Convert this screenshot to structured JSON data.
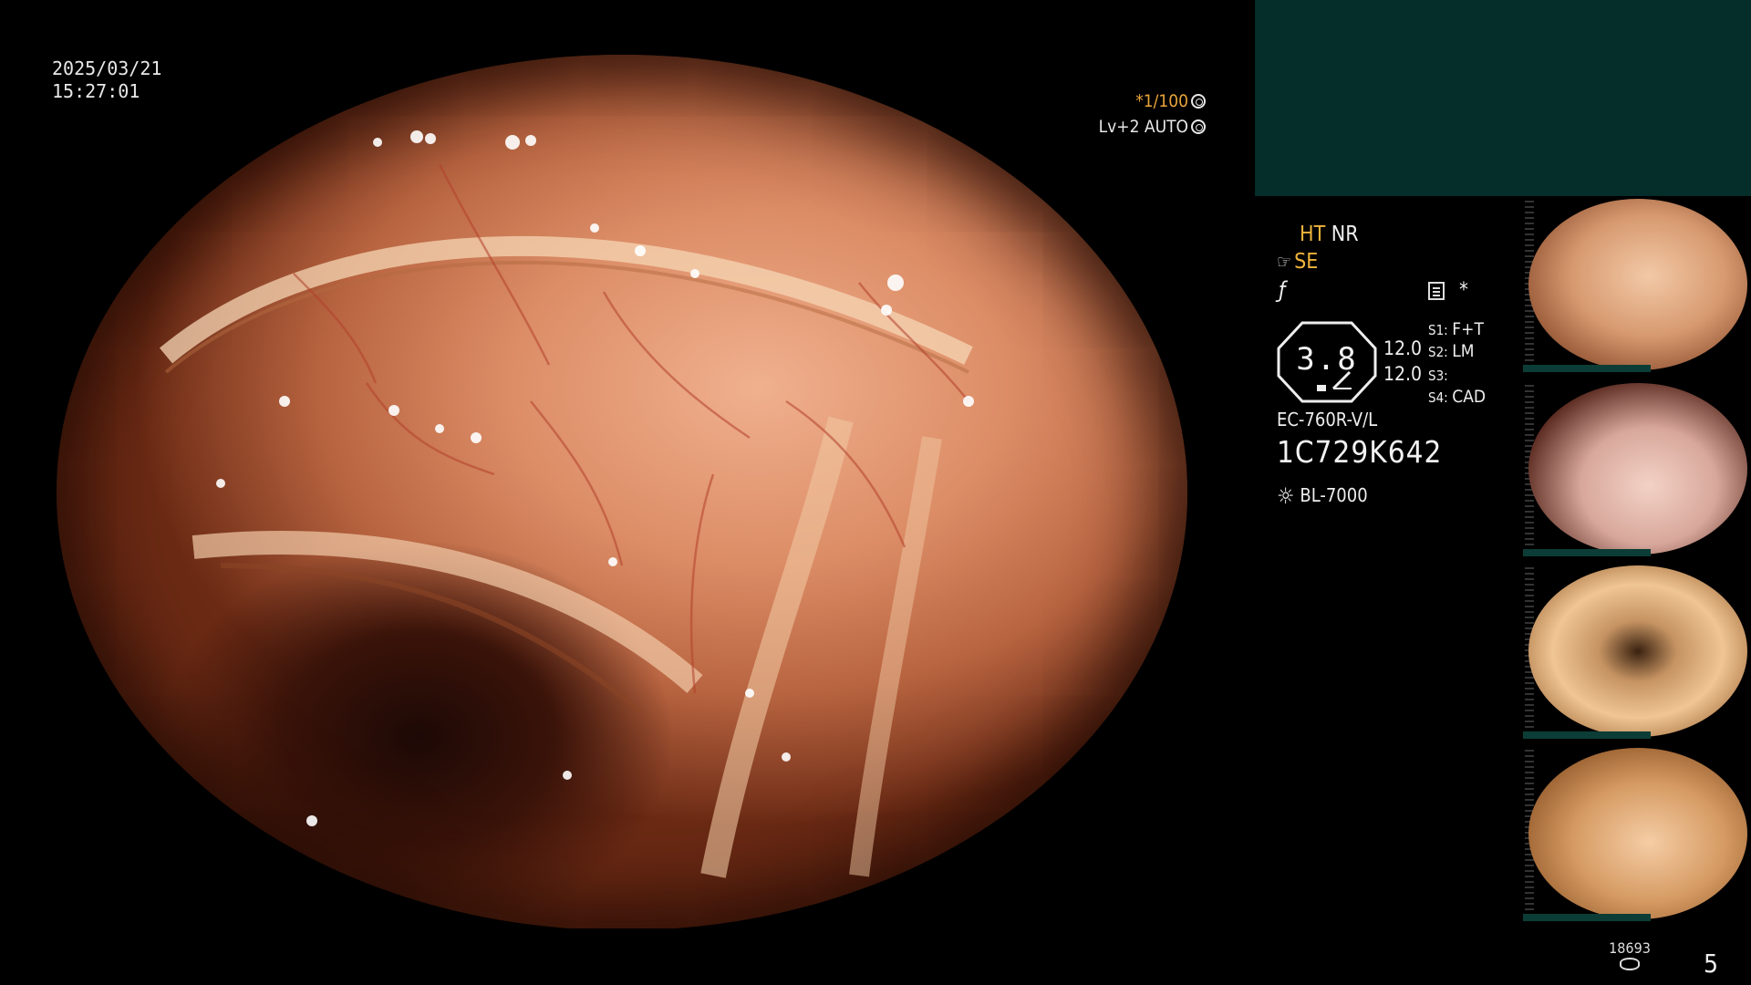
{
  "timestamp": {
    "date": "2025/03/21",
    "time": "15:27:01"
  },
  "scope_osd": {
    "shutter": "*1/100",
    "iris": "Lv+2 AUTO",
    "shutter_icon": "aperture-icon",
    "iris_icon": "iris-icon"
  },
  "panel": {
    "ht": "HT",
    "nr": "NR",
    "se": "SE",
    "se_icon": "hand-icon",
    "f_icon": "f-stroke-icon",
    "star": "*",
    "zoom": "3.8",
    "value1": "12.0",
    "value2": "12.0",
    "switches": [
      {
        "label": "S1:",
        "value": "F+T"
      },
      {
        "label": "S2:",
        "value": "LM"
      },
      {
        "label": "S3:",
        "value": ""
      },
      {
        "label": "S4:",
        "value": "CAD"
      }
    ],
    "model": "EC-760R-V/L",
    "serial": "1C729K642",
    "lamp": "BL-7000",
    "lamp_icon": "sun-icon"
  },
  "footer": {
    "counter": "18693",
    "page": "5"
  },
  "colors": {
    "accent": "#f0b43c",
    "teal_box": "#052d2a",
    "thumb_bar": "#0b3d36"
  }
}
